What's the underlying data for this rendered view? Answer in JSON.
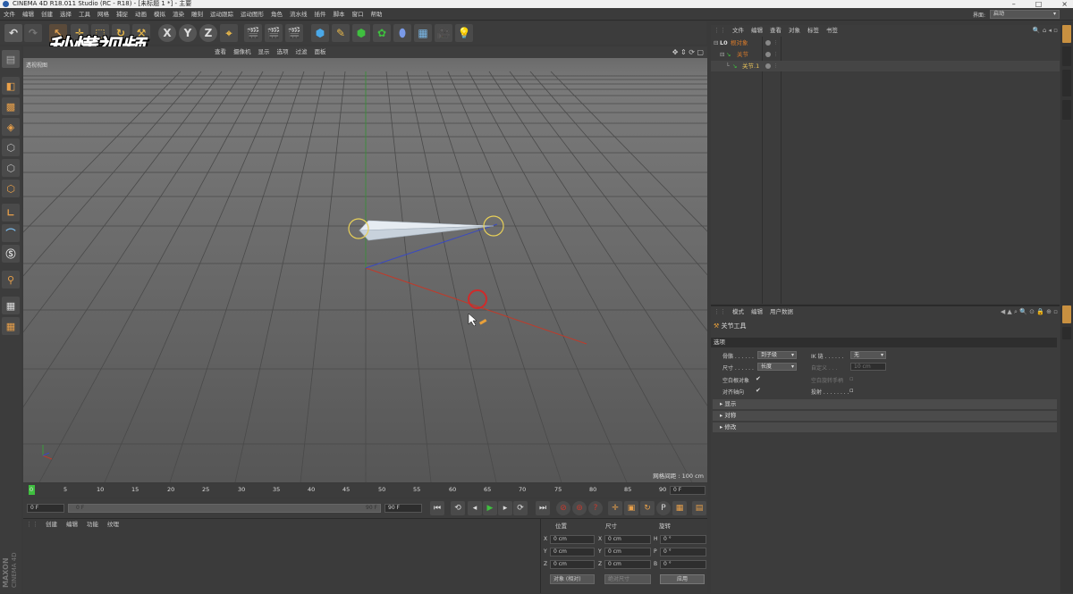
{
  "window": {
    "title": "CINEMA 4D R18.011 Studio (RC - R18) - [未标题 1 *] - 主要"
  },
  "menubar": {
    "items": [
      "文件",
      "编辑",
      "创建",
      "选择",
      "工具",
      "网格",
      "捕捉",
      "动画",
      "模拟",
      "渲染",
      "雕刻",
      "运动跟踪",
      "运动图形",
      "角色",
      "流水线",
      "插件",
      "脚本",
      "窗口",
      "帮助"
    ],
    "layout_label": "界面:",
    "layout_value": "启动"
  },
  "watermark": {
    "text": "秒懂视频"
  },
  "viewport": {
    "menu": [
      "查看",
      "摄像机",
      "显示",
      "选项",
      "过滤",
      "面板"
    ],
    "view_name": "透视视图",
    "grid_spacing": "网格间距 : 100 cm"
  },
  "timeline": {
    "ticks": [
      "0",
      "5",
      "10",
      "15",
      "20",
      "25",
      "30",
      "35",
      "40",
      "45",
      "50",
      "55",
      "60",
      "65",
      "70",
      "75",
      "80",
      "85",
      "90"
    ],
    "current_frame": "0 F",
    "start_frame": "0 F",
    "range_start": "0 F",
    "range_end": "90 F",
    "end_frame": "90 F"
  },
  "material_panel": {
    "menu": [
      "创建",
      "编辑",
      "功能",
      "纹理"
    ]
  },
  "coords": {
    "headers": {
      "position": "位置",
      "size": "尺寸",
      "rotation": "旋转"
    },
    "rows": [
      {
        "axis": "X",
        "pos": "0 cm",
        "size_axis": "X",
        "size": "0 cm",
        "rot_axis": "H",
        "rot": "0 °"
      },
      {
        "axis": "Y",
        "pos": "0 cm",
        "size_axis": "Y",
        "size": "0 cm",
        "rot_axis": "P",
        "rot": "0 °"
      },
      {
        "axis": "Z",
        "pos": "0 cm",
        "size_axis": "Z",
        "size": "0 cm",
        "rot_axis": "B",
        "rot": "0 °"
      }
    ],
    "mode": "对象 (相对)",
    "size_mode": "绝对尺寸",
    "apply": "应用"
  },
  "object_manager": {
    "menu": [
      "文件",
      "编辑",
      "查看",
      "对象",
      "标签",
      "书签"
    ],
    "objects": [
      {
        "name": "根对象",
        "indent": 0
      },
      {
        "name": "关节",
        "indent": 1
      },
      {
        "name": "关节.1",
        "indent": 2
      }
    ]
  },
  "attribute_manager": {
    "menu": [
      "模式",
      "编辑",
      "用户数据"
    ],
    "tool_name": "关节工具",
    "section_options": "选项",
    "props": {
      "bone_label": "骨骼 . . . . . .",
      "bone_value": "到子级",
      "size_label": "尺寸 . . . . . .",
      "size_value": "长度",
      "null_label": "空白根对象",
      "align_label": "对齐轴向",
      "ik_label": "IK 链 . . . . . .",
      "ik_value": "无",
      "custom_label": "自定义 . . .",
      "custom_value": "10 cm",
      "null_rot_label": "空白旋转手柄",
      "project_label": "投射 . . . . . . . ."
    },
    "sections": [
      "显示",
      "对称",
      "修改"
    ]
  },
  "brand": {
    "maxon": "MAXON",
    "c4d": "CINEMA 4D"
  },
  "colors": {
    "accent_orange": "#d87a2a",
    "selected_yellow": "#e8c25a",
    "play_green": "#3fbf3f",
    "record_red": "#c83a2e"
  }
}
